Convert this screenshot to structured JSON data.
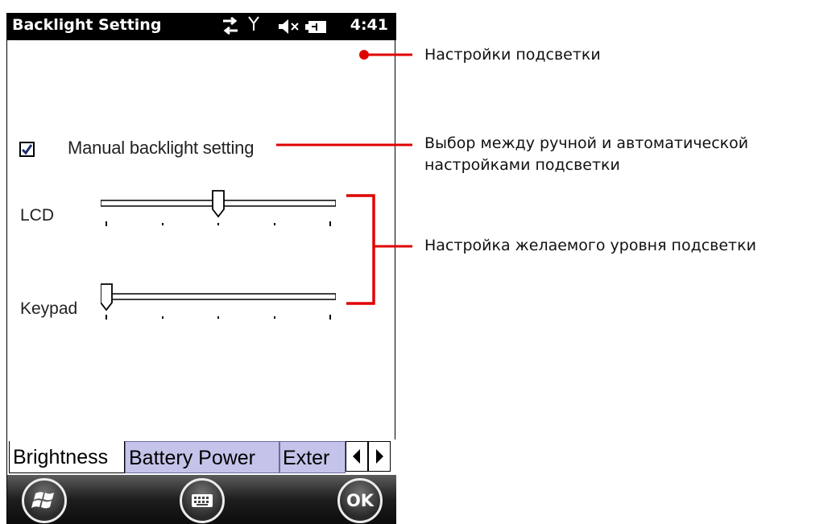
{
  "statusbar": {
    "title": "Backlight Setting",
    "time": "4:41",
    "icons": [
      "sync-arrows-icon",
      "signal-antenna-icon",
      "speaker-muted-icon",
      "battery-charging-icon"
    ]
  },
  "settings": {
    "manual_checkbox_label": "Manual backlight setting",
    "manual_checked": true,
    "lcd_label": "LCD",
    "lcd_level": 0.5,
    "keypad_label": "Keypad",
    "keypad_level": 0.0
  },
  "tabs": [
    {
      "label": "Brightness",
      "active": true
    },
    {
      "label": "Battery Power",
      "active": false
    },
    {
      "label": "Exter",
      "active": false
    }
  ],
  "bottombar": {
    "start_icon": "windows-logo-icon",
    "keyboard_icon": "keyboard-icon",
    "ok_label": "OK"
  },
  "annotations": {
    "settings": "Настройки подсветки",
    "mode_line1": "Выбор между ручной и автоматической",
    "mode_line2": "настройками подсветки",
    "level": "Настройка желаемого уровня подсветки"
  },
  "colors": {
    "annotation_red": "#e00000",
    "tab_inactive": "#c4c4ea",
    "statusbar": "#000000"
  }
}
